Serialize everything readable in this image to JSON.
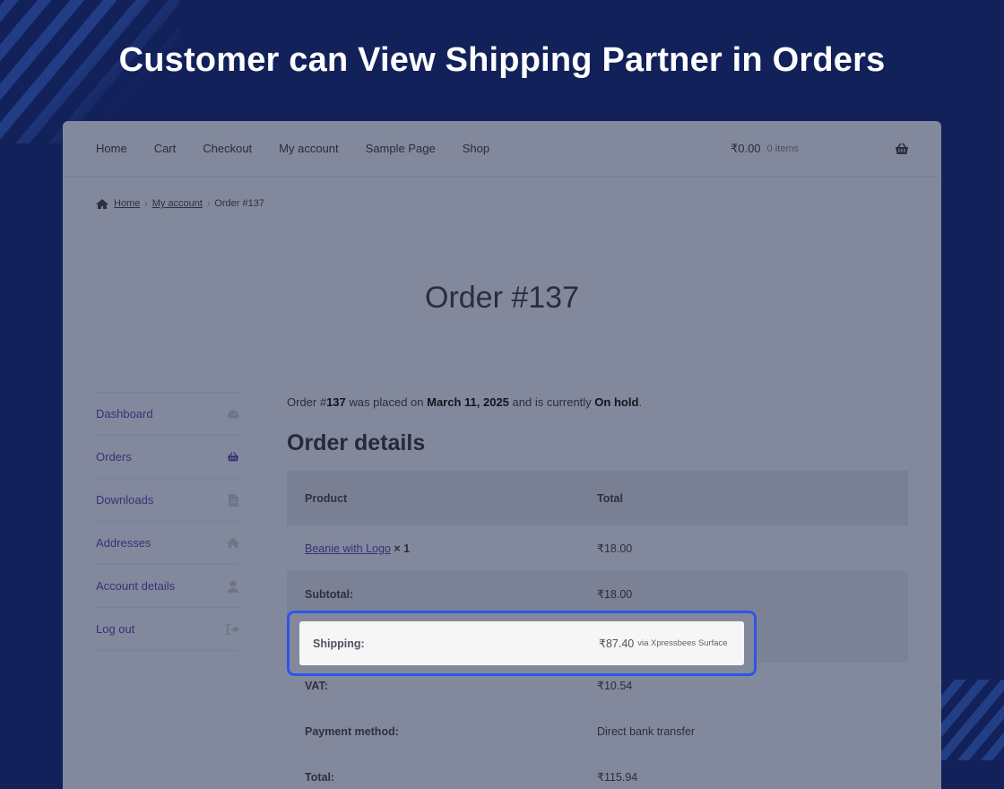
{
  "headline": "Customer can View Shipping Partner in Orders",
  "nav": {
    "items": [
      "Home",
      "Cart",
      "Checkout",
      "My account",
      "Sample Page",
      "Shop"
    ],
    "cart_total": "₹0.00",
    "cart_count": "0 items"
  },
  "breadcrumb": {
    "home": "Home",
    "account": "My account",
    "current": "Order #137",
    "separator": "›"
  },
  "page_title": "Order #137",
  "sidebar": {
    "items": [
      {
        "label": "Dashboard",
        "icon": "dashboard-icon"
      },
      {
        "label": "Orders",
        "icon": "basket-icon"
      },
      {
        "label": "Downloads",
        "icon": "file-icon"
      },
      {
        "label": "Addresses",
        "icon": "home-icon"
      },
      {
        "label": "Account details",
        "icon": "user-icon"
      },
      {
        "label": "Log out",
        "icon": "logout-icon"
      }
    ]
  },
  "order": {
    "intro_prefix": "Order #",
    "number": "137",
    "intro_mid": " was placed on ",
    "date": "March 11, 2025",
    "intro_mid2": " and is currently ",
    "status": "On hold",
    "intro_end": ".",
    "details_title": "Order details",
    "col_product": "Product",
    "col_total": "Total",
    "item_name": "Beanie with Logo",
    "item_qty": "× 1",
    "item_total": "₹18.00",
    "subtotal_label": "Subtotal:",
    "subtotal_value": "₹18.00",
    "shipping_label": "Shipping:",
    "shipping_value": "₹87.40",
    "shipping_via": "via Xpressbees Surface",
    "vat_label": "VAT:",
    "vat_value": "₹10.54",
    "payment_label": "Payment method:",
    "payment_value": "Direct bank transfer",
    "total_label": "Total:",
    "total_value": "₹115.94"
  },
  "colors": {
    "background": "#13215a",
    "highlight_border": "#2f55e8",
    "link": "#3c2f7a"
  }
}
